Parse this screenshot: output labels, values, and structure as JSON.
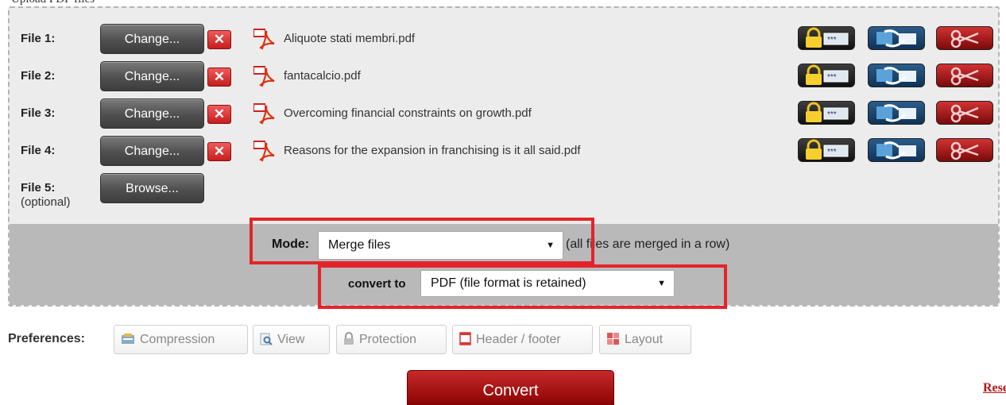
{
  "top_label": "Upload PDF files",
  "files": [
    {
      "label": "File 1:",
      "button": "Change...",
      "remove": "✕",
      "name": "Aliquote stati membri.pdf"
    },
    {
      "label": "File 2:",
      "button": "Change...",
      "remove": "✕",
      "name": "fantacalcio.pdf"
    },
    {
      "label": "File 3:",
      "button": "Change...",
      "remove": "✕",
      "name": "Overcoming financial constraints on growth.pdf"
    },
    {
      "label": "File 4:",
      "button": "Change...",
      "remove": "✕",
      "name": "Reasons for the expansion in franchising is it all said.pdf"
    }
  ],
  "file5": {
    "label": "File 5:",
    "optional": "(optional)",
    "button": "Browse..."
  },
  "mode": {
    "label": "Mode:",
    "value": "Merge files",
    "arrow": "▼",
    "note": "(all files are merged in a row)"
  },
  "convert_to": {
    "label": "convert to",
    "value": "PDF (file format is retained)",
    "arrow": "▼"
  },
  "preferences": {
    "label": "Preferences:",
    "buttons": [
      "Compression",
      "View",
      "Protection",
      "Header / footer",
      "Layout"
    ]
  },
  "convert_button": "Convert",
  "reset_link": "Reset",
  "colors": {
    "highlight": "#e3242b",
    "convert": "#a31010",
    "dark_button": "#4f4f4f",
    "remove": "#d42a2a"
  },
  "icons": [
    "pdf-icon",
    "remove-icon",
    "lock-icon",
    "rotate-icon",
    "scissors-icon",
    "compression-icon",
    "view-icon",
    "protection-icon",
    "header-footer-icon",
    "layout-icon"
  ]
}
